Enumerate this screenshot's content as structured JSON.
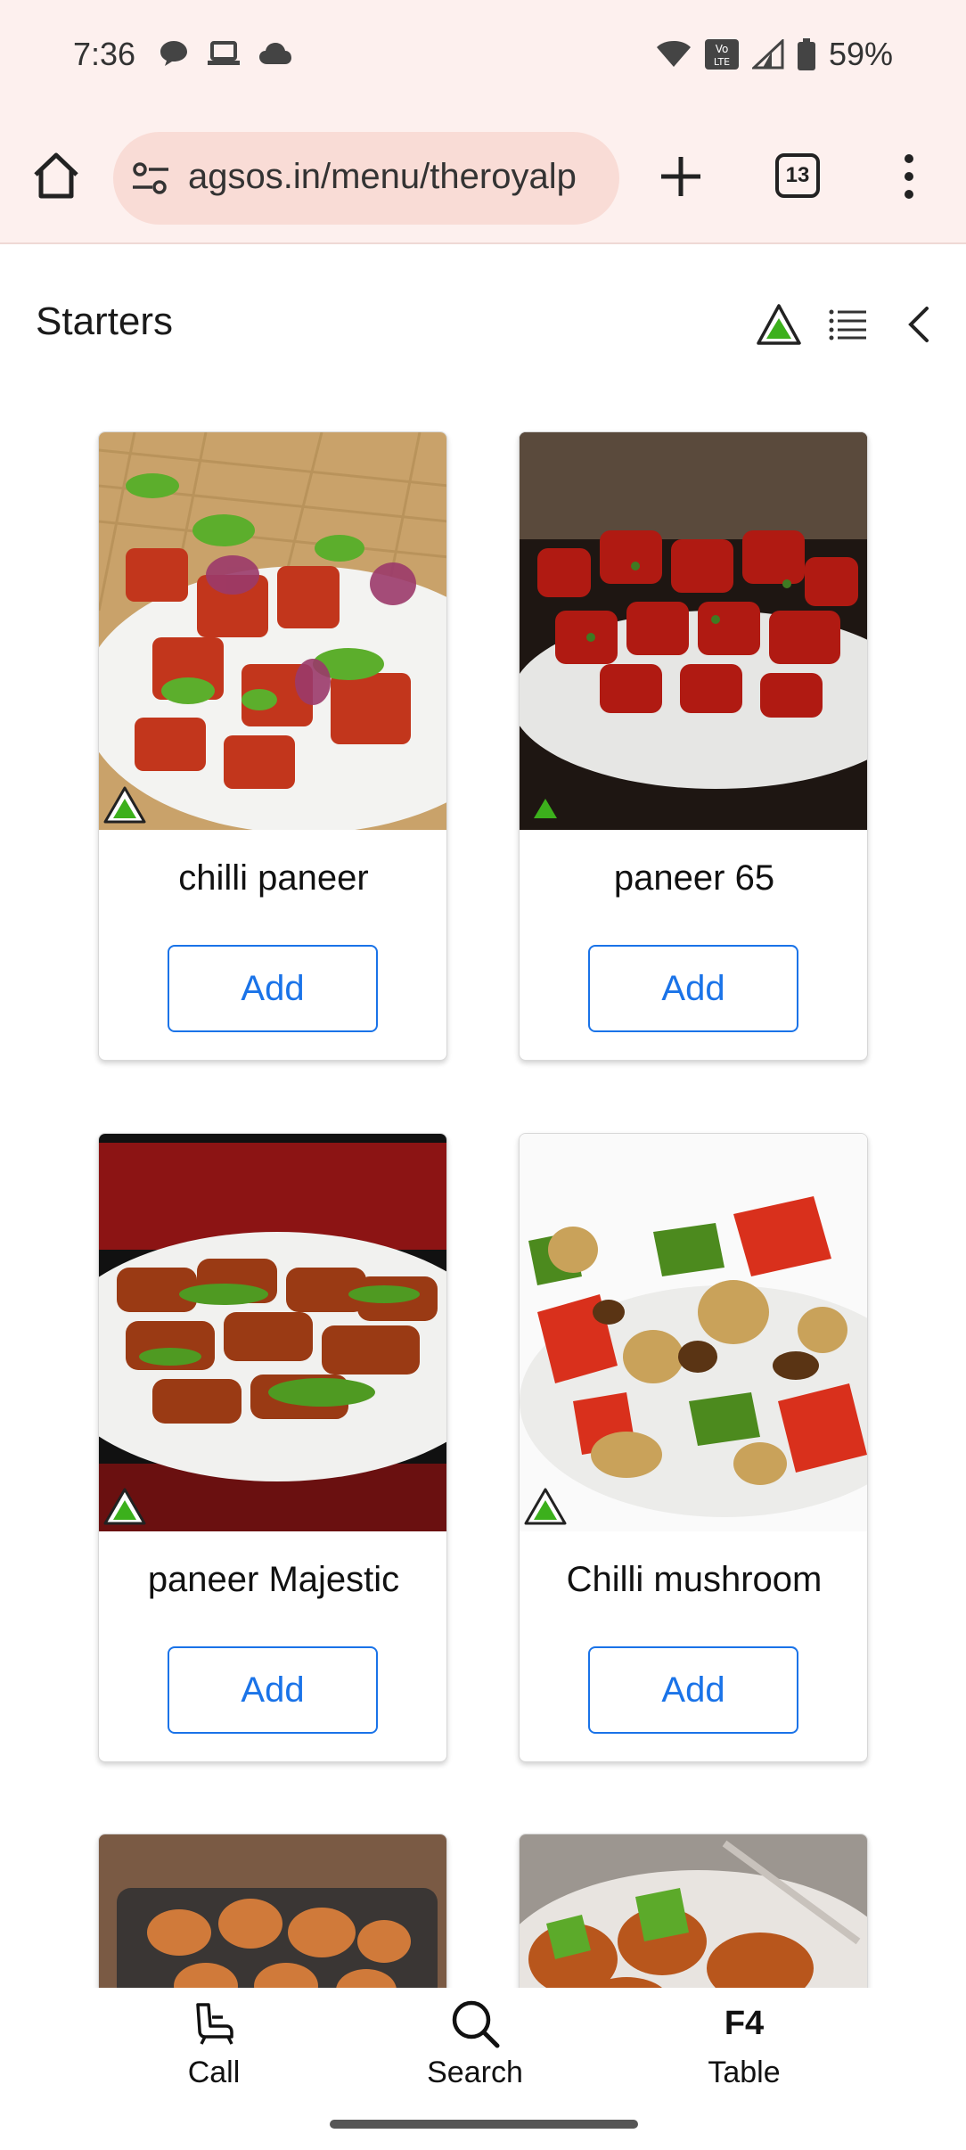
{
  "status": {
    "time": "7:36",
    "battery": "59%",
    "left_icons": [
      "chat-bubble-icon",
      "laptop-icon",
      "cloud-icon"
    ],
    "right_icons": [
      "wifi-icon",
      "volte-icon",
      "signal-icon",
      "battery-icon"
    ]
  },
  "browser": {
    "url": "agsos.in/menu/theroyalp",
    "tab_count": "13"
  },
  "header": {
    "title": "Starters"
  },
  "items": [
    {
      "name": "chilli paneer",
      "add_label": "Add",
      "veg": true
    },
    {
      "name": "paneer 65",
      "add_label": "Add",
      "veg": true
    },
    {
      "name": "paneer Majestic",
      "add_label": "Add",
      "veg": true
    },
    {
      "name": "Chilli mushroom",
      "add_label": "Add",
      "veg": true
    }
  ],
  "bottom_nav": {
    "call": "Call",
    "search": "Search",
    "table_code": "F4",
    "table": "Table"
  },
  "colors": {
    "accent": "#1a73e8",
    "veg_green": "#3cb01c",
    "browser_bg": "#fdf0ee"
  }
}
